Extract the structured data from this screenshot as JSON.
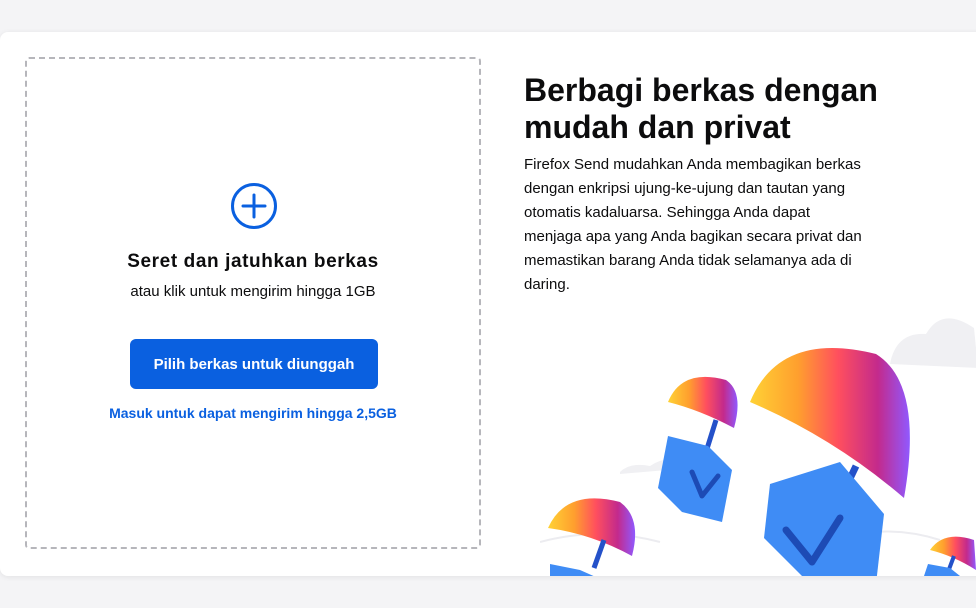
{
  "upload": {
    "icon": "plus-circle-icon",
    "title": "Seret dan jatuhkan berkas",
    "subtitle": "atau klik untuk mengirim hingga 1GB",
    "button_label": "Pilih berkas untuk diunggah",
    "signin_link": "Masuk untuk dapat mengirim hingga 2,5GB"
  },
  "intro": {
    "heading": "Berbagi berkas dengan mudah dan privat",
    "description": "Firefox Send mudahkan Anda membagikan berkas dengan enkripsi ujung-ke-ujung dan tautan yang otomatis kadaluarsa. Sehingga Anda dapat menjaga apa yang Anda bagikan secara privat dan memastikan barang Anda tidak selamanya ada di daring."
  },
  "illustration": {
    "icon": "parachute-files-illustration"
  },
  "colors": {
    "accent": "#0a60e0",
    "text": "#0c0c0d",
    "dashed_border": "#b6b6bb",
    "file_blue": "#3f8cf5"
  }
}
